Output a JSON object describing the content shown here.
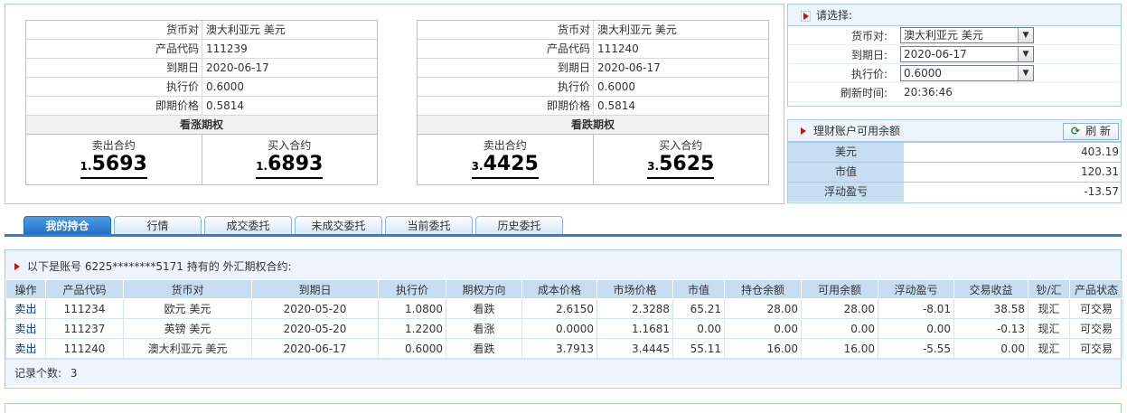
{
  "quotes": [
    {
      "labels": {
        "pair": "货币对",
        "code": "产品代码",
        "expiry": "到期日",
        "strike": "执行价",
        "spot": "即期价格"
      },
      "pair": "澳大利亚元 美元",
      "code": "111239",
      "expiry": "2020-06-17",
      "strike": "0.6000",
      "spot": "0.5814",
      "title": "看涨期权",
      "sell_label": "卖出合约",
      "buy_label": "买入合约",
      "sell_small": "1.",
      "sell_big": "5693",
      "buy_small": "1.",
      "buy_big": "6893"
    },
    {
      "labels": {
        "pair": "货币对",
        "code": "产品代码",
        "expiry": "到期日",
        "strike": "执行价",
        "spot": "即期价格"
      },
      "pair": "澳大利亚元 美元",
      "code": "111240",
      "expiry": "2020-06-17",
      "strike": "0.6000",
      "spot": "0.5814",
      "title": "看跌期权",
      "sell_label": "卖出合约",
      "buy_label": "买入合约",
      "sell_small": "3.",
      "sell_big": "4425",
      "buy_small": "3.",
      "buy_big": "5625"
    }
  ],
  "select_panel": {
    "title": "请选择:",
    "pair_label": "货币对:",
    "pair_value": "澳大利亚元 美元",
    "expiry_label": "到期日:",
    "expiry_value": "2020-06-17",
    "strike_label": "执行价:",
    "strike_value": "0.6000",
    "refresh_time_label": "刷新时间:",
    "refresh_time_value": "20:36:46"
  },
  "balance_panel": {
    "title": "理财账户可用余额",
    "refresh_label": "刷 新",
    "rows": [
      {
        "label": "美元",
        "value": "403.19"
      },
      {
        "label": "市值",
        "value": "120.31"
      },
      {
        "label": "浮动盈亏",
        "value": "-13.57"
      }
    ]
  },
  "tabs": [
    "我的持仓",
    "行情",
    "成交委托",
    "未成交委托",
    "当前委托",
    "历史委托"
  ],
  "positions": {
    "heading": "以下是账号 6225********5171 持有的 外汇期权合约:",
    "columns": [
      "操作",
      "产品代码",
      "货币对",
      "到期日",
      "执行价",
      "期权方向",
      "成本价格",
      "市场价格",
      "市值",
      "持仓余额",
      "可用余额",
      "浮动盈亏",
      "交易收益",
      "钞/汇",
      "产品状态"
    ],
    "rows": [
      [
        "卖出",
        "111234",
        "欧元 美元",
        "2020-05-20",
        "1.0800",
        "看跌",
        "2.6150",
        "2.3288",
        "65.21",
        "28.00",
        "28.00",
        "-8.01",
        "38.58",
        "现汇",
        "可交易"
      ],
      [
        "卖出",
        "111237",
        "英镑 美元",
        "2020-05-20",
        "1.2200",
        "看涨",
        "0.0000",
        "1.1681",
        "0.00",
        "0.00",
        "0.00",
        "0.00",
        "-0.13",
        "现汇",
        "可交易"
      ],
      [
        "卖出",
        "111240",
        "澳大利亚元 美元",
        "2020-06-17",
        "0.6000",
        "看跌",
        "3.7913",
        "3.4445",
        "55.11",
        "16.00",
        "16.00",
        "-5.55",
        "0.00",
        "现汇",
        "可交易"
      ]
    ],
    "record_label": "记录个数:",
    "record_count": "3"
  },
  "colors": {
    "accent": "#2f7fd0",
    "header_bg": "#c7ddf2",
    "panel_border": "#a9cbe9",
    "marker": "#cc1111"
  }
}
